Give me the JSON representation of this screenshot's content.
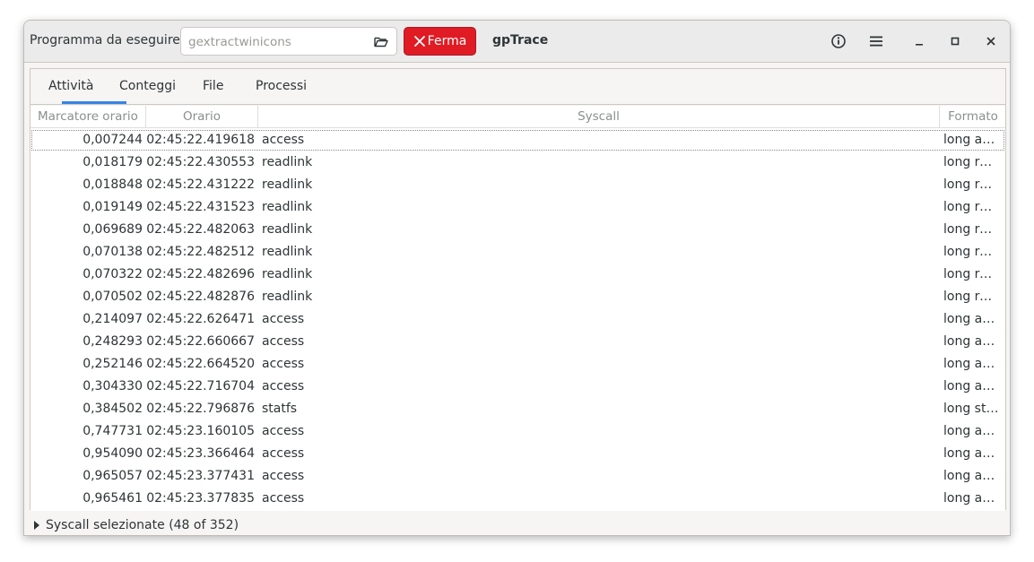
{
  "header": {
    "program_label": "Programma da eseguire:",
    "program_placeholder": "gextractwinicons",
    "stop_label": "Ferma",
    "title": "gpTrace",
    "icons": [
      "folder-open-icon",
      "close-x-icon",
      "info-icon",
      "hamburger-menu-icon",
      "minimize-icon",
      "maximize-icon",
      "close-icon"
    ]
  },
  "tabs": [
    {
      "label": "Attività",
      "active": true
    },
    {
      "label": "Conteggi",
      "active": false
    },
    {
      "label": "File",
      "active": false
    },
    {
      "label": "Processi",
      "active": false
    }
  ],
  "table": {
    "columns": [
      "Marcatore orario",
      "Orario",
      "Syscall",
      "Formato"
    ],
    "rows": [
      [
        "0,007244",
        "02:45:22.419618",
        "access",
        "long ac…"
      ],
      [
        "0,018179",
        "02:45:22.430553",
        "readlink",
        "long re…"
      ],
      [
        "0,018848",
        "02:45:22.431222",
        "readlink",
        "long re…"
      ],
      [
        "0,019149",
        "02:45:22.431523",
        "readlink",
        "long re…"
      ],
      [
        "0,069689",
        "02:45:22.482063",
        "readlink",
        "long re…"
      ],
      [
        "0,070138",
        "02:45:22.482512",
        "readlink",
        "long re…"
      ],
      [
        "0,070322",
        "02:45:22.482696",
        "readlink",
        "long re…"
      ],
      [
        "0,070502",
        "02:45:22.482876",
        "readlink",
        "long re…"
      ],
      [
        "0,214097",
        "02:45:22.626471",
        "access",
        "long ac…"
      ],
      [
        "0,248293",
        "02:45:22.660667",
        "access",
        "long ac…"
      ],
      [
        "0,252146",
        "02:45:22.664520",
        "access",
        "long ac…"
      ],
      [
        "0,304330",
        "02:45:22.716704",
        "access",
        "long ac…"
      ],
      [
        "0,384502",
        "02:45:22.796876",
        "statfs",
        "long st…"
      ],
      [
        "0,747731",
        "02:45:23.160105",
        "access",
        "long ac…"
      ],
      [
        "0,954090",
        "02:45:23.366464",
        "access",
        "long ac…"
      ],
      [
        "0,965057",
        "02:45:23.377431",
        "access",
        "long ac…"
      ],
      [
        "0,965461",
        "02:45:23.377835",
        "access",
        "long ac…"
      ]
    ]
  },
  "footer": {
    "expander_label": "Syscall selezionate (48 of 352)"
  },
  "colors": {
    "accent": "#3584e4",
    "stop_button": "#e01b24"
  }
}
